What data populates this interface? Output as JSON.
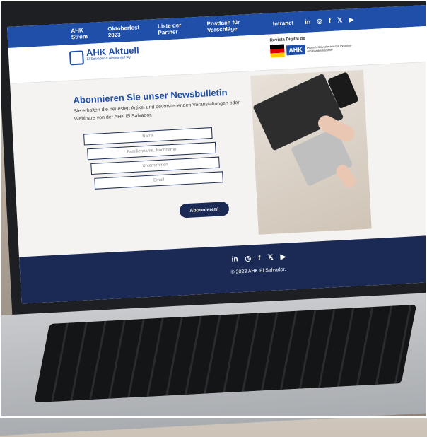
{
  "nav": {
    "items": [
      "AHK Strom",
      "Oktoberfest 2023",
      "Liste der Partner",
      "Postfach für Vorschläge",
      "Intranet"
    ],
    "social": [
      "in",
      "◎",
      "f",
      "𝕏",
      "▶"
    ]
  },
  "header": {
    "logo_title": "AHK Aktuell",
    "logo_sub": "El Salvador & Alemania Hoy",
    "revista_label": "Revista Digital de",
    "revista_badge": "AHK",
    "revista_small": "Deutsch-Salvadorianische Industrie- und Handelskammer"
  },
  "main": {
    "heading": "Abonnieren Sie unser Newsbulletin",
    "description": "Sie erhalten die neuesten Artikel und bevorstehenden Veranstaltungen oder Webinare von der AHK El Salvador.",
    "fields": {
      "name": "Name",
      "family_name": "Familienname, Nachname",
      "company": "Unternehmen",
      "email": "Email"
    },
    "submit": "Abonnieren!"
  },
  "footer": {
    "social": [
      "in",
      "◎",
      "f",
      "𝕏",
      "▶"
    ],
    "copyright": "© 2023 AHK El Salvador."
  },
  "colors": {
    "brand_blue": "#1f4fa8",
    "dark_navy": "#1a2a55"
  }
}
